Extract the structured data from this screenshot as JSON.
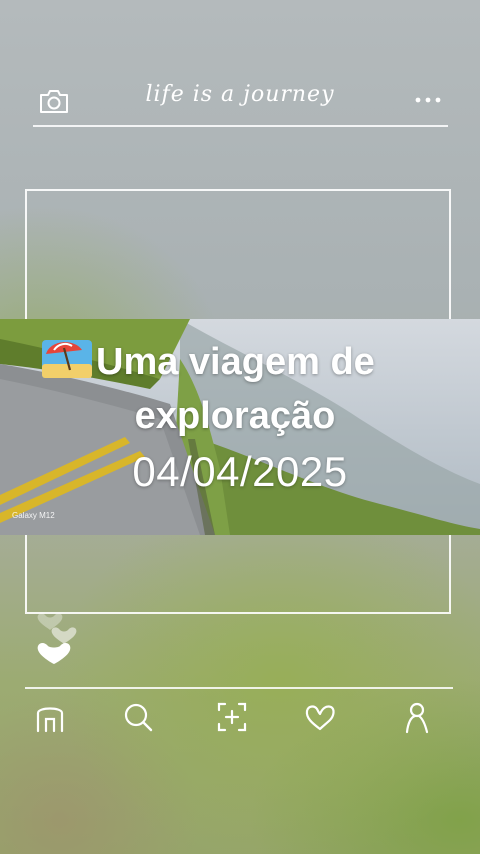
{
  "header": {
    "title": "life is a journey",
    "left_icon": "camera-icon",
    "right_icon": "more-dots-icon"
  },
  "post": {
    "headline_line1": "Uma viagem de",
    "headline_line2": "exploração",
    "headline_emoji": "beach-umbrella-icon",
    "date": "04/04/2025",
    "photo_watermark": "Galaxy M12"
  },
  "reactions": {
    "icon": "floating-hearts-icon"
  },
  "nav": {
    "items": [
      "home-icon",
      "search-icon",
      "add-post-icon",
      "heart-icon",
      "profile-icon"
    ]
  },
  "colors": {
    "line": "#ffffff",
    "text": "#ffffff",
    "road_stripe": "#d8b62a"
  }
}
